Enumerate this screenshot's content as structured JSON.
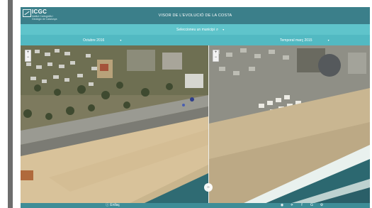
{
  "branding": {
    "logo_text": "ICGC",
    "logo_subtitle": "Institut Cartogràfic i Geològic de Catalunya"
  },
  "header": {
    "title": "VISOR DE L'EVOLUCIÓ DE LA COSTA"
  },
  "municipi": {
    "label": "Seleccioneu un municipi",
    "search_glyph": "⌕",
    "caret": "▾"
  },
  "compare": {
    "left_date": "Octubre 2016",
    "right_date": "Temporal març 2015",
    "caret": "▾"
  },
  "map": {
    "zoom_in": "+",
    "zoom_out": "−",
    "swipe_glyph": "‹›"
  },
  "footer": {
    "link": "ⓘ Enllaç",
    "social": [
      "◉",
      "✈",
      "f",
      "G",
      "⚙"
    ]
  },
  "colors": {
    "header": "#3b7f8a",
    "municipi_bar": "#5fc4cb",
    "date_bar": "#52b9c2",
    "footer": "#3e8d97",
    "sand": "#d8c29a",
    "sea": "#2f6b73",
    "foam": "#e9f1ee"
  }
}
